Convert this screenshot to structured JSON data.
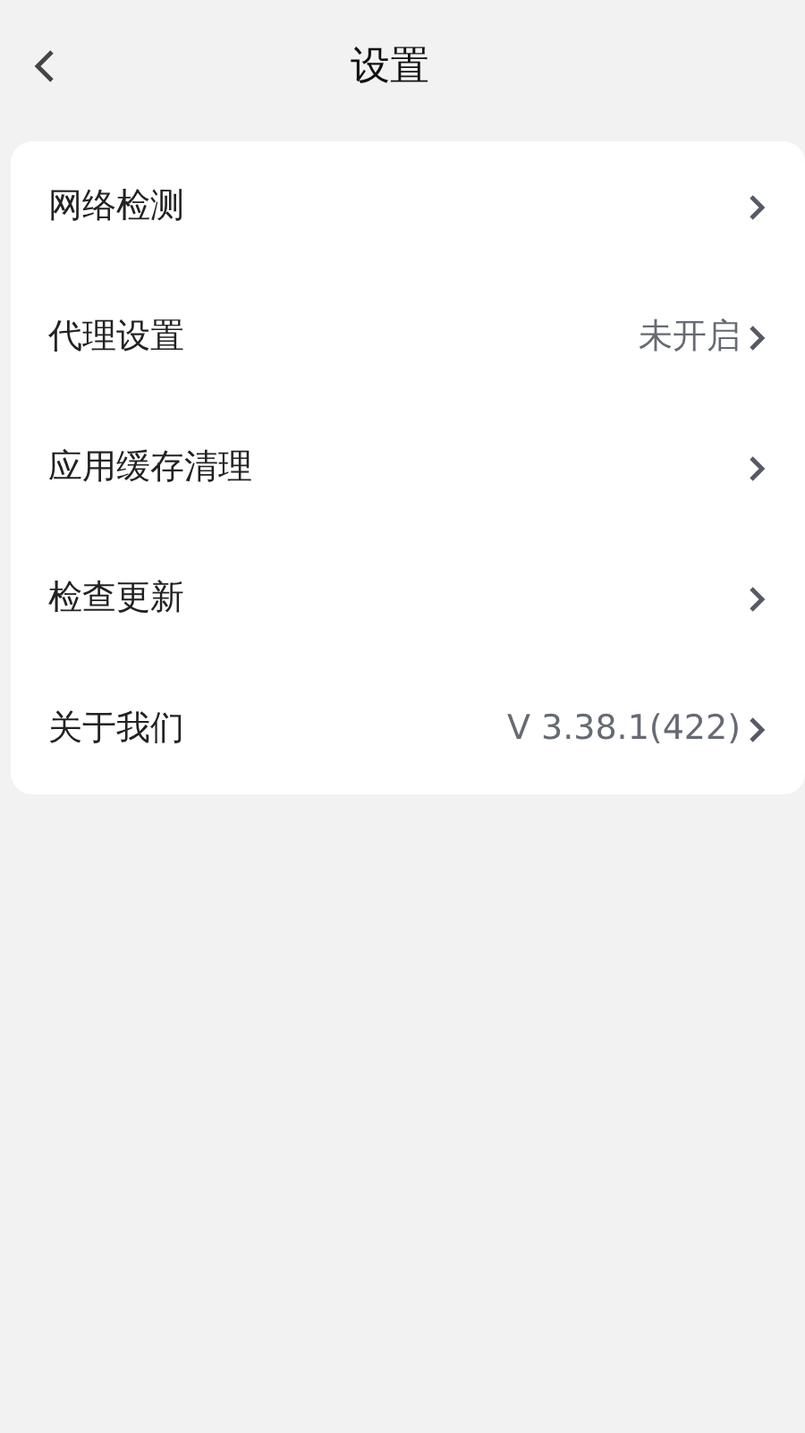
{
  "header": {
    "title": "设置"
  },
  "items": [
    {
      "label": "网络检测"
    },
    {
      "label": "代理设置",
      "value": "未开启"
    },
    {
      "label": "应用缓存清理"
    },
    {
      "label": "检查更新"
    },
    {
      "label": "关于我们",
      "value": "V 3.38.1(422)"
    }
  ]
}
